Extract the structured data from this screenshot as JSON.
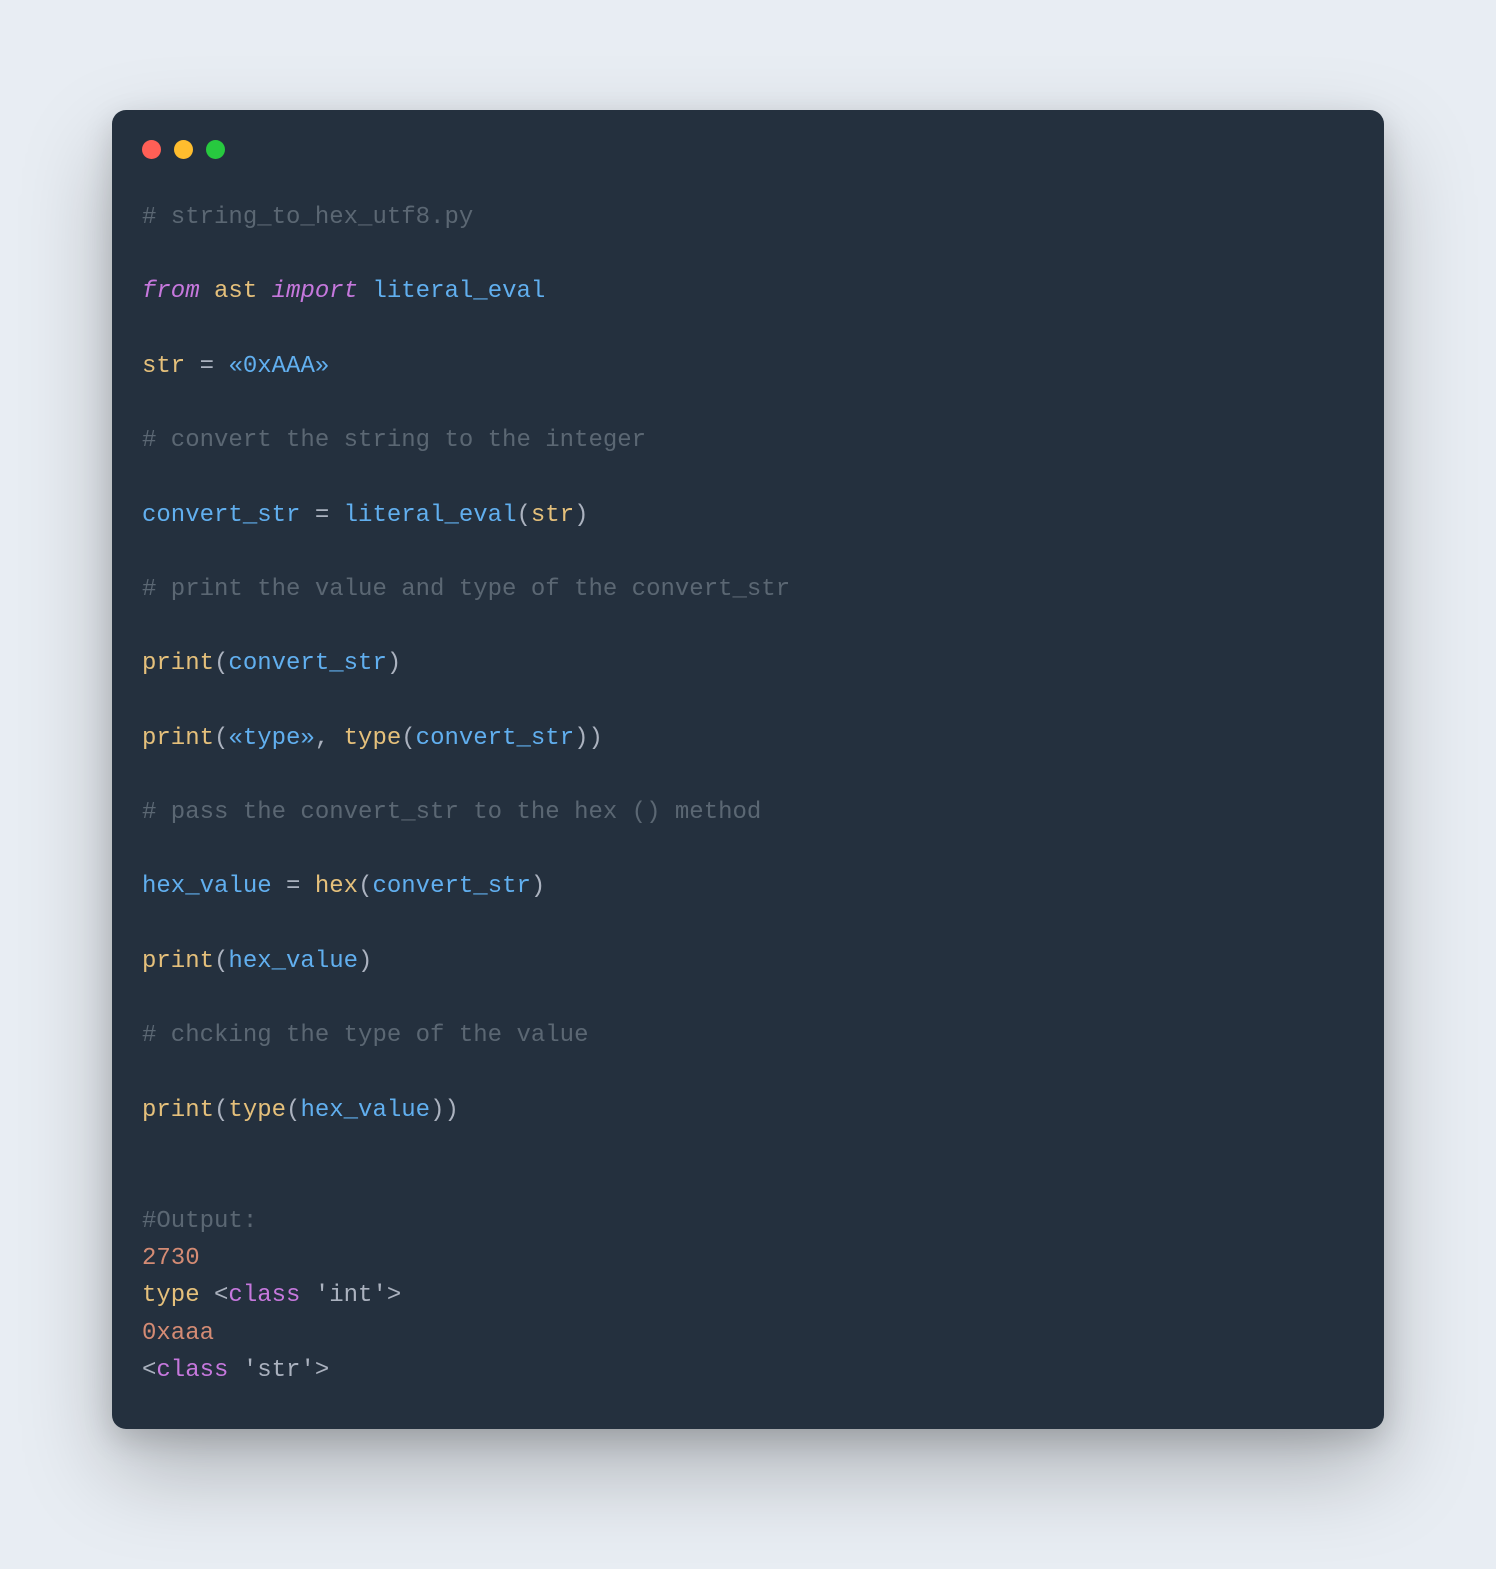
{
  "code": {
    "l1_comment": "# string_to_hex_utf8.py",
    "l3_from": "from",
    "l3_module": "ast",
    "l3_import": "import",
    "l3_name": "literal_eval",
    "l5_lhs": "str",
    "l5_eq": " = ",
    "l5_str": "«0xAAA»",
    "l7_comment": "# convert the string to the integer",
    "l9_lhs": "convert_str",
    "l9_eq": " = ",
    "l9_call": "literal_eval",
    "l9_lp": "(",
    "l9_arg": "str",
    "l9_rp": ")",
    "l11_comment": "# print the value and type of the convert_str",
    "l13_call": "print",
    "l13_lp": "(",
    "l13_arg": "convert_str",
    "l13_rp": ")",
    "l15_call": "print",
    "l15_lp": "(",
    "l15_arg1": "«type»",
    "l15_comma": ", ",
    "l15_type": "type",
    "l15_lp2": "(",
    "l15_arg2": "convert_str",
    "l15_rp2": ")",
    "l15_rp": ")",
    "l17_comment": "# pass the convert_str to the hex () method",
    "l19_lhs": "hex_value",
    "l19_eq": " = ",
    "l19_call": "hex",
    "l19_lp": "(",
    "l19_arg": "convert_str",
    "l19_rp": ")",
    "l21_call": "print",
    "l21_lp": "(",
    "l21_arg": "hex_value",
    "l21_rp": ")",
    "l23_comment": "# chcking the type of the value",
    "l25_call": "print",
    "l25_lp": "(",
    "l25_type": "type",
    "l25_lp2": "(",
    "l25_arg": "hex_value",
    "l25_rp2": ")",
    "l25_rp": ")",
    "out_header": "#Output:",
    "out_1": "2730",
    "out_2_type": "type",
    "out_2_lt": " <",
    "out_2_class": "class",
    "out_2_sp": " ",
    "out_2_val": "'int'",
    "out_2_gt": ">",
    "out_3": "0xaaa",
    "out_4_lt": "<",
    "out_4_class": "class",
    "out_4_sp": " ",
    "out_4_val": "'str'",
    "out_4_gt": ">"
  }
}
